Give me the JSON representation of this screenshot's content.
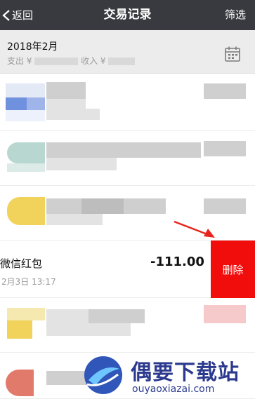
{
  "header": {
    "back_label": "返回",
    "title": "交易记录",
    "filter_label": "筛选"
  },
  "month": {
    "title": "2018年2月",
    "expense_label": "支出 ¥",
    "income_label": "收入 ¥"
  },
  "transaction": {
    "title": "微信红包",
    "time": "2月3日 13:17",
    "amount": "-111.00",
    "delete_label": "删除"
  },
  "watermark": {
    "name": "偶要下载站",
    "url": "ouyaoxiazai.com"
  },
  "colors": {
    "header_bg": "#393a3f",
    "delete_bg": "#f10d0c",
    "arrow": "#e8241c",
    "watermark": "#2b3a8f"
  }
}
